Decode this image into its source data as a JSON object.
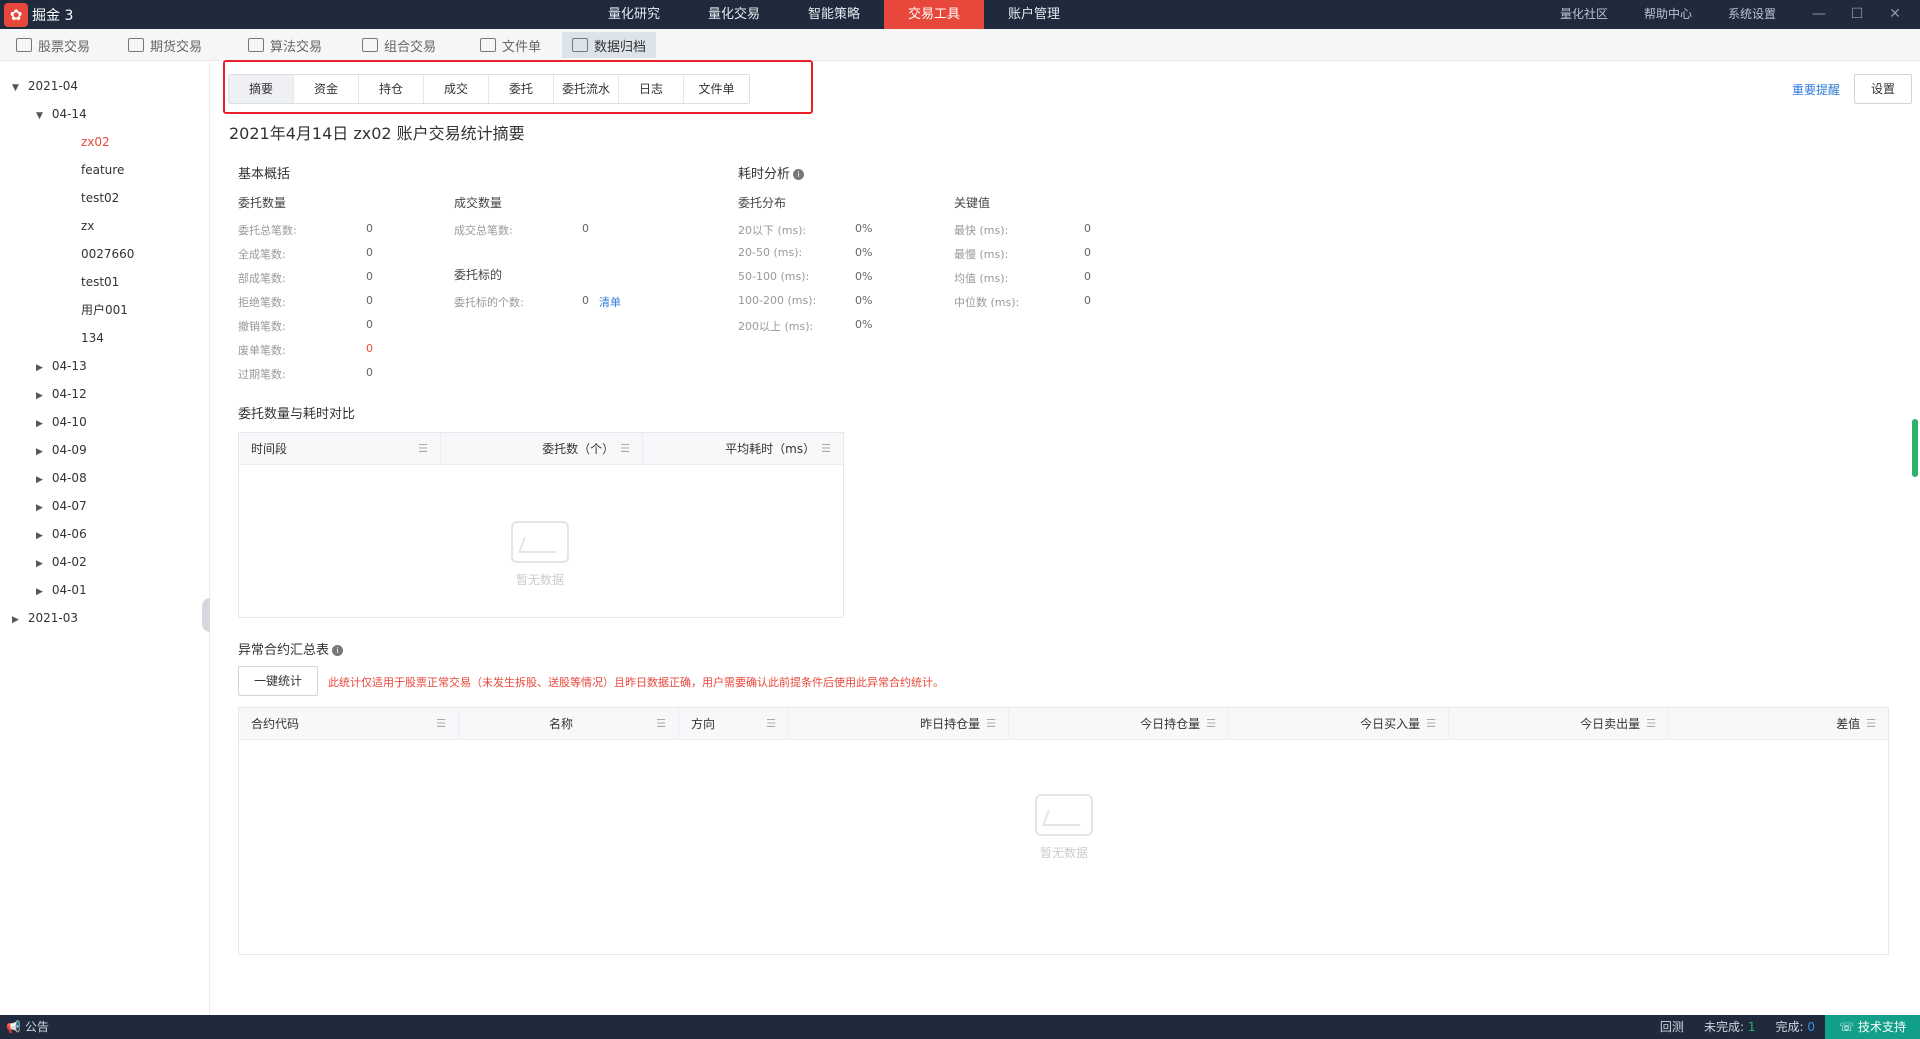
{
  "app": {
    "name": "掘金 3",
    "logo_char": "✿"
  },
  "topnav": [
    "量化研究",
    "量化交易",
    "智能策略",
    "交易工具",
    "账户管理"
  ],
  "topnav_active": 3,
  "topright": [
    "量化社区",
    "帮助中心",
    "系统设置"
  ],
  "window_controls": [
    "—",
    "☐",
    "✕"
  ],
  "toolbar": [
    {
      "label": "股票交易",
      "icon": "stock-icon"
    },
    {
      "label": "期货交易",
      "icon": "futures-icon"
    },
    {
      "label": "算法交易",
      "icon": "percent-icon"
    },
    {
      "label": "组合交易",
      "icon": "basket-icon"
    },
    {
      "label": "文件单",
      "icon": "file-icon"
    },
    {
      "label": "数据归档",
      "icon": "layers-icon"
    }
  ],
  "tree": {
    "root1": "2021-04",
    "root1_child": "04-14",
    "accounts": [
      "zx02",
      "feature",
      "test02",
      "zx",
      "0027660",
      "test01",
      "用户001",
      "134"
    ],
    "dates": [
      "04-13",
      "04-12",
      "04-10",
      "04-09",
      "04-08",
      "04-07",
      "04-06",
      "04-02",
      "04-01"
    ],
    "root2": "2021-03"
  },
  "tabs": [
    "摘要",
    "资金",
    "持仓",
    "成交",
    "委托",
    "委托流水",
    "日志",
    "文件单"
  ],
  "actions": {
    "remind": "重要提醒",
    "settings": "设置"
  },
  "title": "2021年4月14日 zx02 账户交易统计摘要",
  "basic": {
    "heading": "基本概括",
    "orders_h": "委托数量",
    "orders": [
      {
        "k": "委托总笔数:",
        "v": "0"
      },
      {
        "k": "全成笔数:",
        "v": "0"
      },
      {
        "k": "部成笔数:",
        "v": "0"
      },
      {
        "k": "拒绝笔数:",
        "v": "0"
      },
      {
        "k": "撤销笔数:",
        "v": "0"
      },
      {
        "k": "废单笔数:",
        "v": "0"
      },
      {
        "k": "过期笔数:",
        "v": "0"
      }
    ],
    "trades_h": "成交数量",
    "trades": [
      {
        "k": "成交总笔数:",
        "v": "0"
      }
    ],
    "targets_h": "委托标的",
    "targets": [
      {
        "k": "委托标的个数:",
        "v": "0",
        "link": "清单"
      }
    ]
  },
  "timing": {
    "heading": "耗时分析",
    "dist_h": "委托分布",
    "dist": [
      {
        "k": "20以下 (ms):",
        "v": "0%"
      },
      {
        "k": "20-50 (ms):",
        "v": "0%"
      },
      {
        "k": "50-100 (ms):",
        "v": "0%"
      },
      {
        "k": "100-200 (ms):",
        "v": "0%"
      },
      {
        "k": "200以上 (ms):",
        "v": "0%"
      }
    ],
    "key_h": "关键值",
    "key": [
      {
        "k": "最快 (ms):",
        "v": "0"
      },
      {
        "k": "最慢 (ms):",
        "v": "0"
      },
      {
        "k": "均值 (ms):",
        "v": "0"
      },
      {
        "k": "中位数 (ms):",
        "v": "0"
      }
    ]
  },
  "compare": {
    "heading": "委托数量与耗时对比",
    "columns": [
      "时间段",
      "委托数（个）",
      "平均耗时（ms）"
    ],
    "empty": "暂无数据"
  },
  "abnormal": {
    "heading": "异常合约汇总表",
    "button": "一键统计",
    "warning": "此统计仅适用于股票正常交易（未发生拆股、送股等情况）且昨日数据正确，用户需要确认此前提条件后使用此异常合约统计。",
    "columns": [
      "合约代码",
      "名称",
      "方向",
      "昨日持仓量",
      "今日持仓量",
      "今日买入量",
      "今日卖出量",
      "差值"
    ],
    "empty": "暂无数据"
  },
  "status": {
    "notice": "公告",
    "backtest": "回测",
    "pending_label": "未完成:",
    "pending": "1",
    "done_label": "完成:",
    "done": "0",
    "support": "技术支持"
  },
  "colors": {
    "accent": "#e8483b",
    "topbar": "#1f2b3c",
    "link": "#2f7bd9",
    "highlight": "#e8202a"
  }
}
